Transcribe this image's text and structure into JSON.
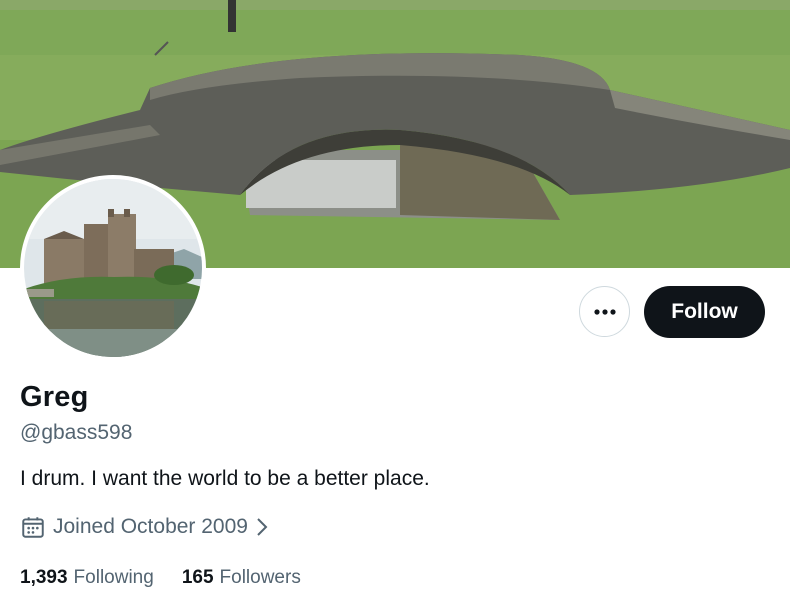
{
  "profile": {
    "name": "Greg",
    "handle": "@gbass598",
    "bio": "I drum. I want the world to be a better place.",
    "joined": "Joined October 2009",
    "following_count": "1,393",
    "following_label": "Following",
    "followers_count": "165",
    "followers_label": "Followers"
  },
  "actions": {
    "follow_label": "Follow",
    "more_icon": "more-horizontal-icon"
  },
  "icons": {
    "joined": "calendar-icon",
    "joined_chevron": "chevron-right-icon"
  },
  "colors": {
    "primary_text": "#0f1419",
    "secondary_text": "#536471",
    "button_bg": "#0f1419",
    "border": "#cfd9de"
  }
}
